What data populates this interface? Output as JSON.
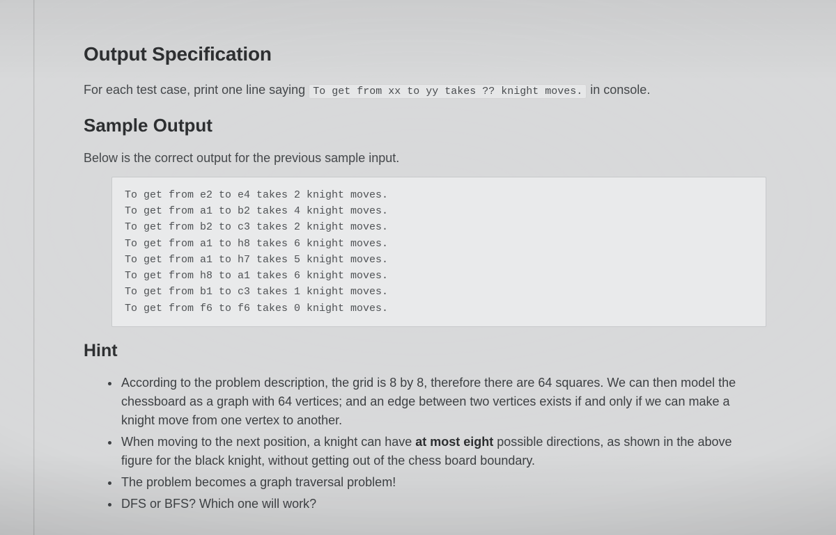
{
  "sections": {
    "output_spec_heading": "Output Specification",
    "output_spec_body_pre": "For each test case, print one line saying ",
    "output_spec_code": "To get from xx to yy takes ?? knight moves.",
    "output_spec_body_post": " in console.",
    "sample_output_heading": "Sample Output",
    "sample_output_body": "Below is the correct output for the previous sample input.",
    "sample_output_code": "To get from e2 to e4 takes 2 knight moves.\nTo get from a1 to b2 takes 4 knight moves.\nTo get from b2 to c3 takes 2 knight moves.\nTo get from a1 to h8 takes 6 knight moves.\nTo get from a1 to h7 takes 5 knight moves.\nTo get from h8 to a1 takes 6 knight moves.\nTo get from b1 to c3 takes 1 knight moves.\nTo get from f6 to f6 takes 0 knight moves.",
    "hint_heading": "Hint",
    "hints": [
      {
        "pre": "According to the problem description, the grid is 8 by 8, therefore there are 64 squares. We can then model the chessboard as a graph with 64 vertices; and an edge between two vertices exists if and only if we can make a knight move from one vertex to another.",
        "bold": "",
        "post": ""
      },
      {
        "pre": "When moving to the next position, a knight can have ",
        "bold": "at most eight",
        "post": " possible directions, as shown in the above figure for the black knight, without getting out of the chess board boundary."
      },
      {
        "pre": "The problem becomes a graph traversal problem!",
        "bold": "",
        "post": ""
      },
      {
        "pre": "DFS or BFS? Which one will work?",
        "bold": "",
        "post": ""
      }
    ]
  }
}
